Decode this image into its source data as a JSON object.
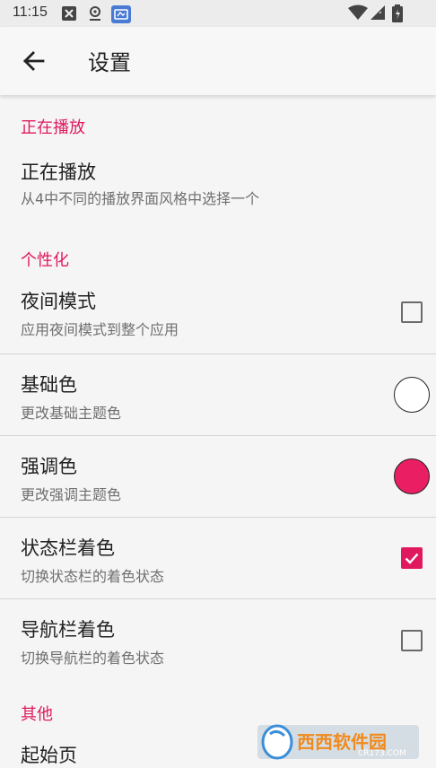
{
  "status_bar": {
    "time": "11:15"
  },
  "toolbar": {
    "title": "设置"
  },
  "sections": {
    "now_playing": {
      "header": "正在播放",
      "item_title": "正在播放",
      "item_summary": "从4中不同的播放界面风格中选择一个"
    },
    "personalize": {
      "header": "个性化",
      "night_mode": {
        "title": "夜间模式",
        "summary": "应用夜间模式到整个应用",
        "checked": false
      },
      "primary_color": {
        "title": "基础色",
        "summary": "更改基础主题色",
        "color": "#ffffff"
      },
      "accent_color": {
        "title": "强调色",
        "summary": "更改强调主题色",
        "color": "#e91e63"
      },
      "status_bar_tint": {
        "title": "状态栏着色",
        "summary": "切换状态栏的着色状态",
        "checked": true
      },
      "nav_bar_tint": {
        "title": "导航栏着色",
        "summary": "切换导航栏的着色状态",
        "checked": false
      }
    },
    "other": {
      "header": "其他",
      "start_page": {
        "title": "起始页"
      }
    }
  },
  "accent": "#e0195f",
  "watermark": {
    "text_cn": "西西软件园",
    "text_en": "CR173.COM"
  }
}
